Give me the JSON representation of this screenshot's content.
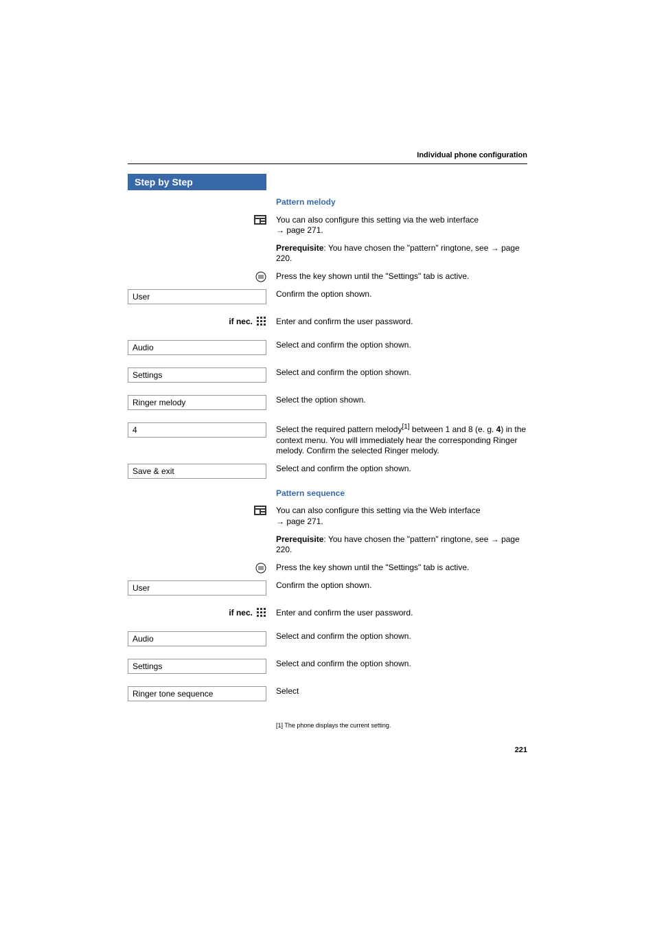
{
  "header": {
    "title": "Individual phone configuration"
  },
  "step_header": "Step by Step",
  "pattern_melody": {
    "heading": "Pattern melody",
    "web_text_1": "You can also configure this setting via the web interface ",
    "web_arrow": "→",
    "web_page_ref": " page 271.",
    "prereq_label": "Prerequisite",
    "prereq_text": ": You have chosen the \"pattern\" ringtone, see ",
    "prereq_arrow": "→",
    "prereq_page_ref": " page 220.",
    "press_key_text": "Press the key shown until the \"Settings\" tab is active.",
    "user_label": "User",
    "user_desc": "Confirm the option shown.",
    "if_nec": "if nec.",
    "password_desc": "Enter and confirm the user password.",
    "audio_label": "Audio",
    "audio_desc": "Select and confirm the option shown.",
    "settings_label": "Settings",
    "settings_desc": "Select and confirm the option shown.",
    "ringer_label": "Ringer melody",
    "ringer_desc": "Select the option shown.",
    "value_label": "4",
    "value_desc_1": "Select the required pattern melody",
    "value_foot_ref": "[1]",
    "value_desc_2": " between 1 and 8 (e. g. ",
    "value_bold": "4",
    "value_desc_3": ") in the context menu. You will immediately hear the corresponding Ringer melody. Confirm the selected Ringer melody.",
    "save_label": "Save & exit",
    "save_desc": "Select and confirm the option shown."
  },
  "pattern_sequence": {
    "heading": "Pattern sequence",
    "web_text_1": "You can also configure this setting via the Web interface ",
    "web_arrow": "→",
    "web_page_ref": " page 271.",
    "prereq_label": "Prerequisite",
    "prereq_text": ": You have chosen the \"pattern\" ringtone, see ",
    "prereq_arrow": "→",
    "prereq_page_ref": " page 220.",
    "press_key_text": "Press the key shown until the \"Settings\" tab is active.",
    "user_label": "User",
    "user_desc": "Confirm the option shown.",
    "if_nec": "if nec.",
    "password_desc": "Enter and confirm the user password.",
    "audio_label": "Audio",
    "audio_desc": "Select and confirm the option shown.",
    "settings_label": "Settings",
    "settings_desc": "Select and confirm the option shown.",
    "tone_label": "Ringer tone sequence",
    "tone_desc": "Select"
  },
  "footnote": "[1] The phone displays the current setting.",
  "page_number": "221"
}
